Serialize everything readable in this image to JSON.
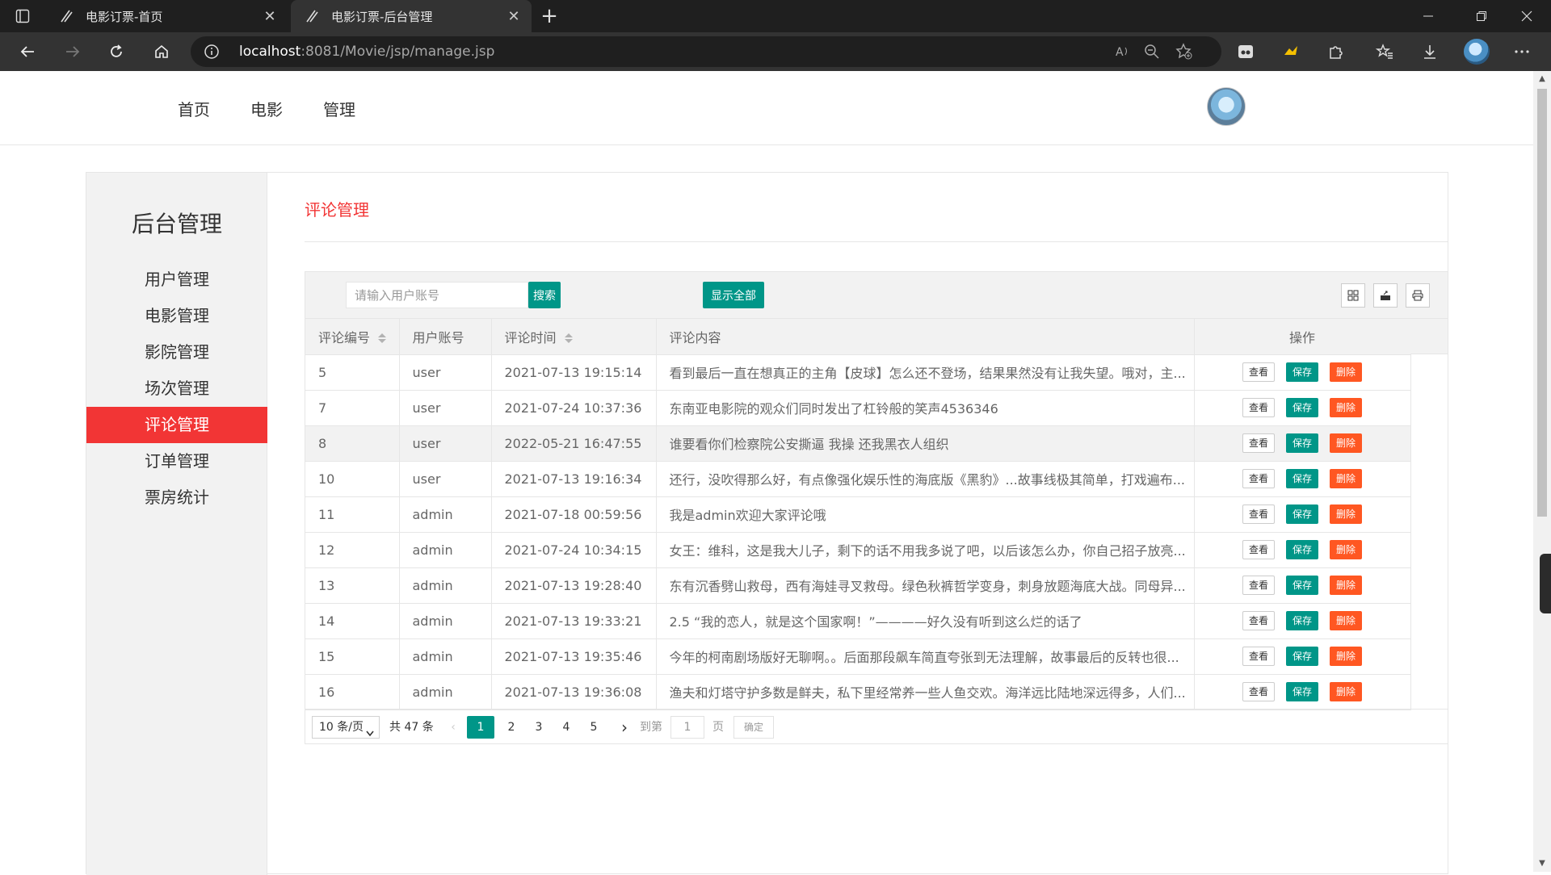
{
  "browser": {
    "tabs": [
      {
        "title": "电影订票-首页",
        "active": false
      },
      {
        "title": "电影订票-后台管理",
        "active": true
      }
    ],
    "url_host": "localhost",
    "url_rest": ":8081/Movie/jsp/manage.jsp"
  },
  "topnav": {
    "items": [
      "首页",
      "电影",
      "管理"
    ]
  },
  "sidebar": {
    "title": "后台管理",
    "items": [
      "用户管理",
      "电影管理",
      "影院管理",
      "场次管理",
      "评论管理",
      "订单管理",
      "票房统计"
    ],
    "active_index": 4
  },
  "main": {
    "section_title": "评论管理",
    "search_placeholder": "请输入用户账号",
    "search_button": "搜索",
    "show_all_button": "显示全部",
    "tool_icons": [
      "columns-filter-icon",
      "export-icon",
      "print-icon"
    ]
  },
  "table": {
    "headers": {
      "id": "评论编号",
      "user": "用户账号",
      "time": "评论时间",
      "content": "评论内容",
      "action": "操作"
    },
    "action_labels": {
      "view": "查看",
      "save": "保存",
      "delete": "删除"
    },
    "rows": [
      {
        "id": "5",
        "user": "user",
        "time": "2021-07-13 19:15:14",
        "content": "看到最后一直在想真正的主角【皮球】怎么还不登场，结果果然没有让我失望。哦对，主..."
      },
      {
        "id": "7",
        "user": "user",
        "time": "2021-07-24 10:37:36",
        "content": "东南亚电影院的观众们同时发出了杠铃般的笑声4536346"
      },
      {
        "id": "8",
        "user": "user",
        "time": "2022-05-21 16:47:55",
        "content": "谁要看你们检察院公安撕逼 我操 还我黑衣人组织"
      },
      {
        "id": "10",
        "user": "user",
        "time": "2021-07-13 19:16:34",
        "content": "还行，没吹得那么好，有点像强化娱乐性的海底版《黑豹》...故事线极其简单，打戏遍布..."
      },
      {
        "id": "11",
        "user": "admin",
        "time": "2021-07-18 00:59:56",
        "content": "我是admin欢迎大家评论哦"
      },
      {
        "id": "12",
        "user": "admin",
        "time": "2021-07-24 10:34:15",
        "content": "女王：维科，这是我大儿子，剩下的话不用我多说了吧，以后该怎么办，你自己招子放亮..."
      },
      {
        "id": "13",
        "user": "admin",
        "time": "2021-07-13 19:28:40",
        "content": "东有沉香劈山救母，西有海娃寻叉救母。绿色秋裤哲学变身，刺身放题海底大战。同母异..."
      },
      {
        "id": "14",
        "user": "admin",
        "time": "2021-07-13 19:33:21",
        "content": "2.5 “我的恋人，就是这个国家啊！”————好久没有听到这么烂的话了"
      },
      {
        "id": "15",
        "user": "admin",
        "time": "2021-07-13 19:35:46",
        "content": "今年的柯南剧场版好无聊啊。。后面那段飙车简直夸张到无法理解，故事最后的反转也很..."
      },
      {
        "id": "16",
        "user": "admin",
        "time": "2021-07-13 19:36:08",
        "content": "渔夫和灯塔守护多数是鲜夫，私下里经常养一些人鱼交欢。海洋远比陆地深远得多，人们..."
      }
    ],
    "highlighted_row": 2
  },
  "pager": {
    "limit": "10 条/页",
    "total": "共 47 条",
    "pages": [
      "1",
      "2",
      "3",
      "4",
      "5"
    ],
    "current": "1",
    "goto_label": "到第",
    "goto_value": "1",
    "page_label": "页",
    "confirm": "确定"
  },
  "colors": {
    "accent_red": "#f23535",
    "teal": "#009688",
    "danger": "#ff5722"
  }
}
